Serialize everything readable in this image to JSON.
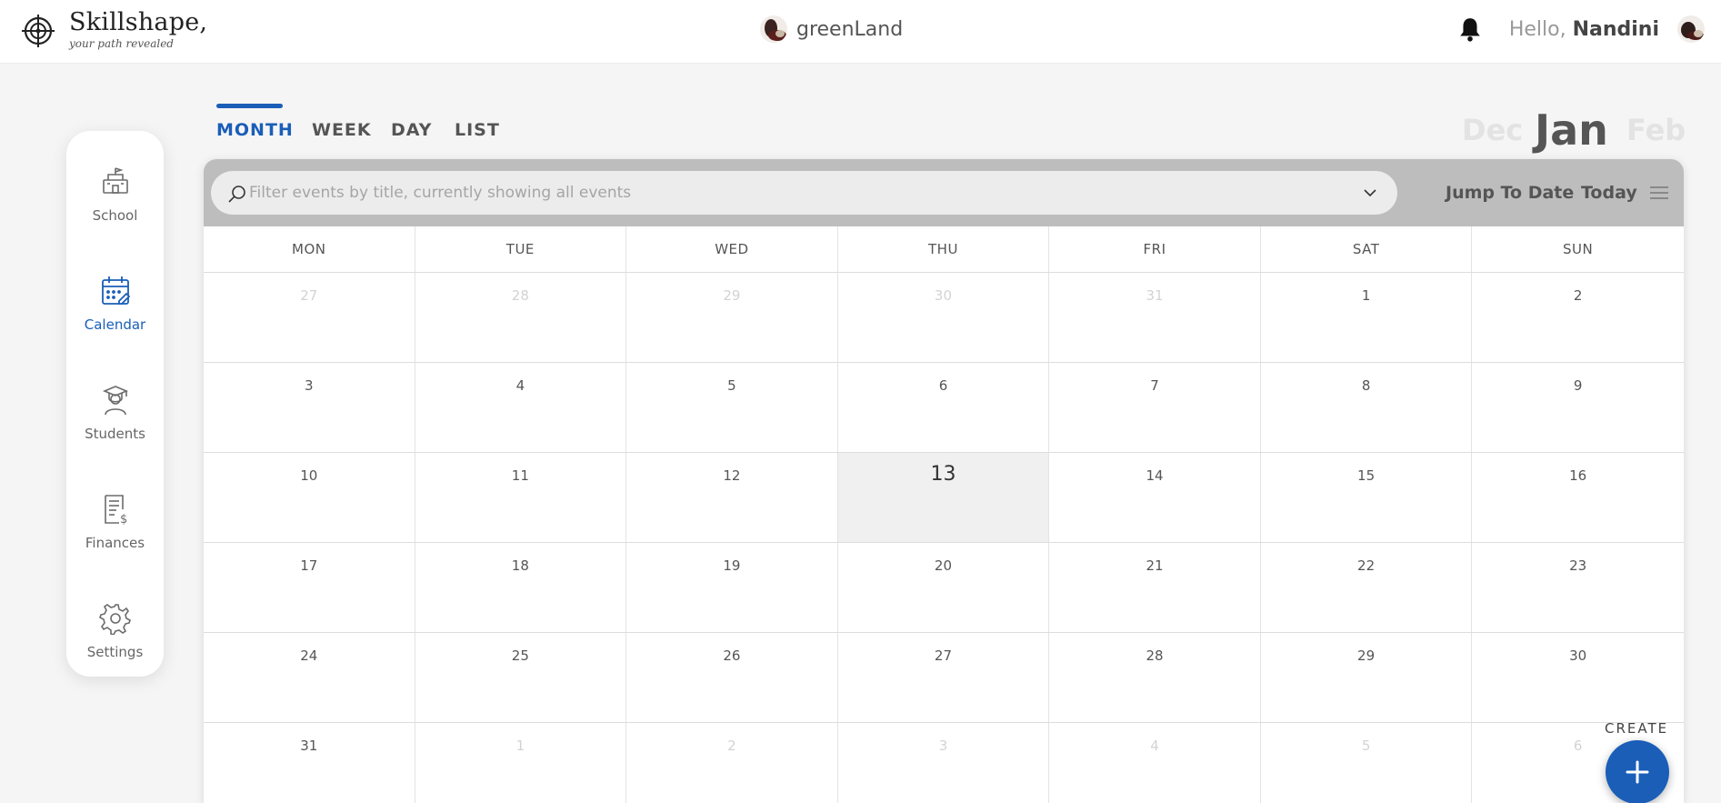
{
  "brand": {
    "name": "Skillshape,",
    "tagline": "your path revealed"
  },
  "org": {
    "name": "greenLand"
  },
  "user": {
    "greeting": "Hello,",
    "name": "Nandini"
  },
  "sidebar": {
    "items": [
      {
        "label": "School",
        "icon": "school-icon",
        "active": false
      },
      {
        "label": "Calendar",
        "icon": "calendar-icon",
        "active": true
      },
      {
        "label": "Students",
        "icon": "student-icon",
        "active": false
      },
      {
        "label": "Finances",
        "icon": "finances-icon",
        "active": false
      },
      {
        "label": "Settings",
        "icon": "gear-icon",
        "active": false
      }
    ]
  },
  "tabs": [
    {
      "label": "MONTH",
      "active": true
    },
    {
      "label": "WEEK",
      "active": false
    },
    {
      "label": "DAY",
      "active": false
    },
    {
      "label": "LIST",
      "active": false
    }
  ],
  "months": {
    "prev": "Dec",
    "current": "Jan",
    "next": "Feb"
  },
  "toolbar": {
    "search_placeholder": "Filter events by title, currently showing all events",
    "jump_label": "Jump To Date",
    "today_label": "Today"
  },
  "calendar": {
    "weekdays": [
      "MON",
      "TUE",
      "WED",
      "THU",
      "FRI",
      "SAT",
      "SUN"
    ],
    "today": "13",
    "weeks": [
      {
        "days": [
          "27",
          "28",
          "29",
          "30",
          "31",
          "1",
          "2"
        ],
        "muted": [
          true,
          true,
          true,
          true,
          true,
          false,
          false
        ]
      },
      {
        "days": [
          "3",
          "4",
          "5",
          "6",
          "7",
          "8",
          "9"
        ],
        "muted": [
          false,
          false,
          false,
          false,
          false,
          false,
          false
        ]
      },
      {
        "days": [
          "10",
          "11",
          "12",
          "13",
          "14",
          "15",
          "16"
        ],
        "muted": [
          false,
          false,
          false,
          false,
          false,
          false,
          false
        ]
      },
      {
        "days": [
          "17",
          "18",
          "19",
          "20",
          "21",
          "22",
          "23"
        ],
        "muted": [
          false,
          false,
          false,
          false,
          false,
          false,
          false
        ]
      },
      {
        "days": [
          "24",
          "25",
          "26",
          "27",
          "28",
          "29",
          "30"
        ],
        "muted": [
          false,
          false,
          false,
          false,
          false,
          false,
          false
        ]
      },
      {
        "days": [
          "31",
          "1",
          "2",
          "3",
          "4",
          "5",
          "6"
        ],
        "muted": [
          false,
          true,
          true,
          true,
          true,
          true,
          true
        ]
      }
    ]
  },
  "create": {
    "label": "CREATE"
  },
  "colors": {
    "accent": "#1a5eb8",
    "toolbar_bg": "#bdbdbd",
    "today_bg": "#f0f0f0"
  }
}
